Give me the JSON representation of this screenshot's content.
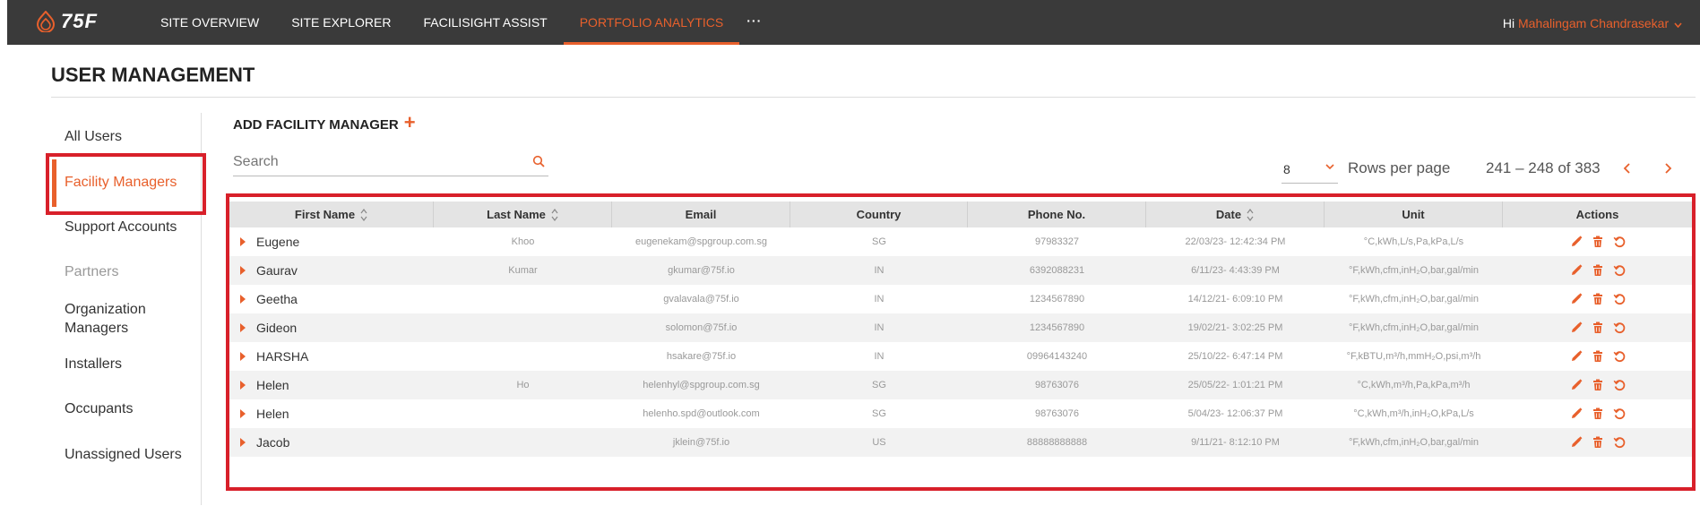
{
  "header": {
    "logo_text": "75F",
    "nav": [
      "SITE OVERVIEW",
      "SITE EXPLORER",
      "FACILISIGHT ASSIST",
      "PORTFOLIO ANALYTICS"
    ],
    "more": "···",
    "greeting_prefix": "Hi",
    "user_name": "Mahalingam Chandrasekar",
    "accent": "#e8602c"
  },
  "page": {
    "title": "USER MANAGEMENT"
  },
  "sidebar": {
    "items": [
      {
        "label": "All Users"
      },
      {
        "label": "Facility Managers"
      },
      {
        "label": "Support Accounts"
      },
      {
        "label": "Partners"
      },
      {
        "label": "Organization Managers"
      },
      {
        "label": "Installers"
      },
      {
        "label": "Occupants"
      },
      {
        "label": "Unassigned Users"
      }
    ]
  },
  "toolbar": {
    "add_label": "ADD FACILITY MANAGER",
    "add_icon": "+",
    "search_placeholder": "Search",
    "rows_value": "8",
    "rows_label": "Rows per page",
    "range": "241 – 248 of 383"
  },
  "table": {
    "columns": [
      "First Name",
      "Last Name",
      "Email",
      "Country",
      "Phone No.",
      "Date",
      "Unit",
      "Actions"
    ],
    "rows": [
      {
        "first": "Eugene",
        "last": "Khoo",
        "email": "eugenekam@spgroup.com.sg",
        "country": "SG",
        "phone": "97983327",
        "date": "22/03/23- 12:42:34 PM",
        "unit": "°C,kWh,L/s,Pa,kPa,L/s"
      },
      {
        "first": "Gaurav",
        "last": "Kumar",
        "email": "gkumar@75f.io",
        "country": "IN",
        "phone": "6392088231",
        "date": "6/11/23- 4:43:39 PM",
        "unit": "°F,kWh,cfm,inH₂O,bar,gal/min"
      },
      {
        "first": "Geetha",
        "last": "",
        "email": "gvalavala@75f.io",
        "country": "IN",
        "phone": "1234567890",
        "date": "14/12/21- 6:09:10 PM",
        "unit": "°F,kWh,cfm,inH₂O,bar,gal/min"
      },
      {
        "first": "Gideon",
        "last": "",
        "email": "solomon@75f.io",
        "country": "IN",
        "phone": "1234567890",
        "date": "19/02/21- 3:02:25 PM",
        "unit": "°F,kWh,cfm,inH₂O,bar,gal/min"
      },
      {
        "first": "HARSHA",
        "last": "",
        "email": "hsakare@75f.io",
        "country": "IN",
        "phone": "09964143240",
        "date": "25/10/22- 6:47:14 PM",
        "unit": "°F,kBTU,m³/h,mmH₂O,psi,m³/h"
      },
      {
        "first": "Helen",
        "last": "Ho",
        "email": "helenhyl@spgroup.com.sg",
        "country": "SG",
        "phone": "98763076",
        "date": "25/05/22- 1:01:21 PM",
        "unit": "°C,kWh,m³/h,Pa,kPa,m³/h"
      },
      {
        "first": "Helen",
        "last": "",
        "email": "helenho.spd@outlook.com",
        "country": "SG",
        "phone": "98763076",
        "date": "5/04/23- 12:06:37 PM",
        "unit": "°C,kWh,m³/h,inH₂O,kPa,L/s"
      },
      {
        "first": "Jacob",
        "last": "",
        "email": "jklein@75f.io",
        "country": "US",
        "phone": "88888888888",
        "date": "9/11/21- 8:12:10 PM",
        "unit": "°F,kWh,cfm,inH₂O,bar,gal/min"
      }
    ]
  }
}
